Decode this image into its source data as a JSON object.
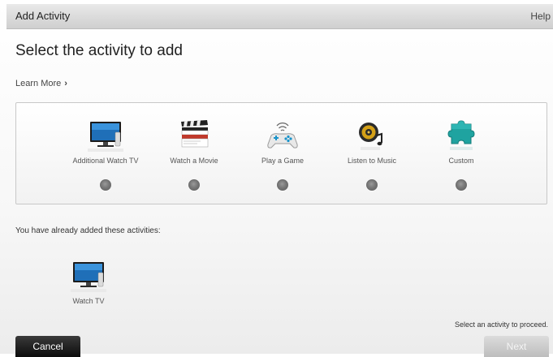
{
  "window": {
    "title": "Add Activity",
    "help_label": "Help"
  },
  "main": {
    "heading": "Select the activity to add",
    "learn_more": "Learn More",
    "learn_more_chevron": "›"
  },
  "activities": [
    {
      "label": "Additional Watch TV",
      "icon": "tv-icon"
    },
    {
      "label": "Watch a Movie",
      "icon": "clapperboard-icon"
    },
    {
      "label": "Play a Game",
      "icon": "gamepad-icon"
    },
    {
      "label": "Listen to Music",
      "icon": "music-speaker-icon"
    },
    {
      "label": "Custom",
      "icon": "puzzle-piece-icon"
    }
  ],
  "added": {
    "label": "You have already added these activities:",
    "items": [
      {
        "label": "Watch TV",
        "icon": "tv-icon"
      }
    ]
  },
  "footer": {
    "status": "Select an activity to proceed.",
    "cancel_label": "Cancel",
    "next_label": "Next"
  },
  "colors": {
    "accent": "#1a93c9",
    "panel_border": "#c8c8c8"
  }
}
